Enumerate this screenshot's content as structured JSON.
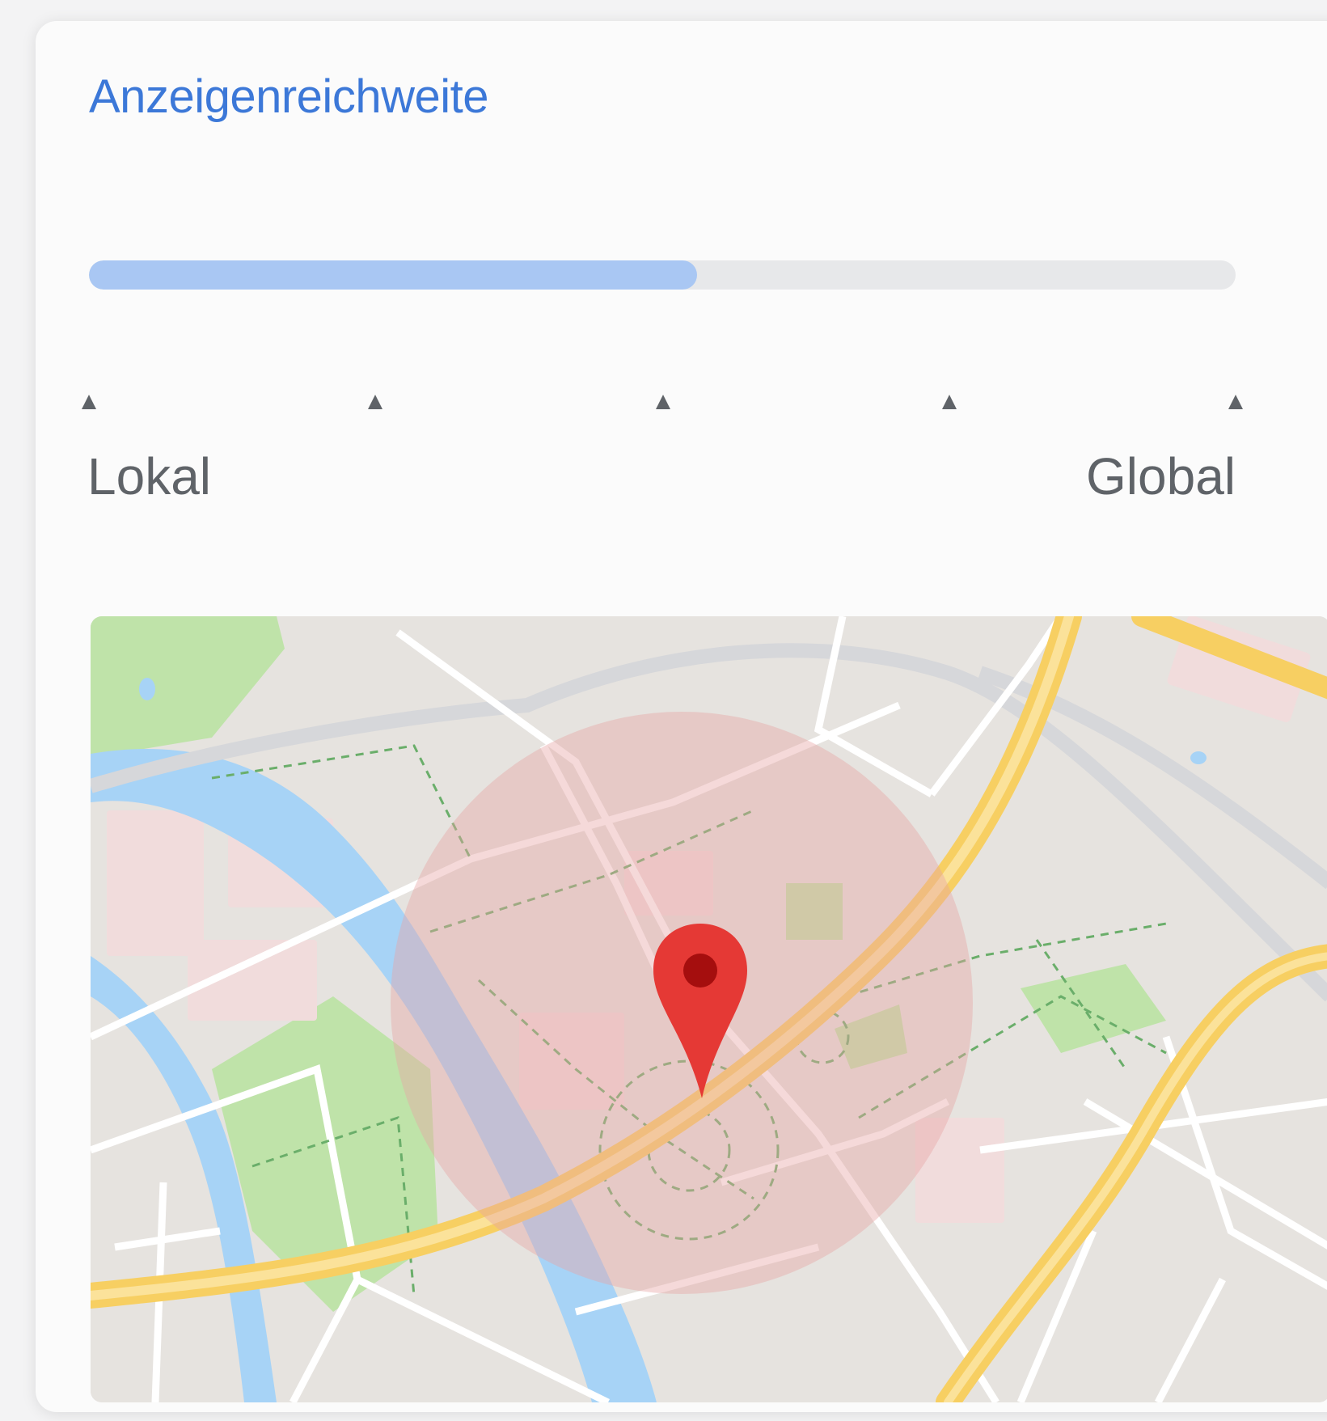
{
  "reach": {
    "title": "Anzeigenreichweite",
    "slider_value_percent": 53,
    "tick_count": 5,
    "min_label": "Lokal",
    "max_label": "Global"
  },
  "map": {
    "marker_icon": "map-pin-icon",
    "colors": {
      "marker": "#e53935",
      "radius_fill": "#e8a5a5",
      "park": "#b8e3a3",
      "water": "#9fcff5",
      "highway": "#f6d06b",
      "building": "#f3dada"
    }
  }
}
